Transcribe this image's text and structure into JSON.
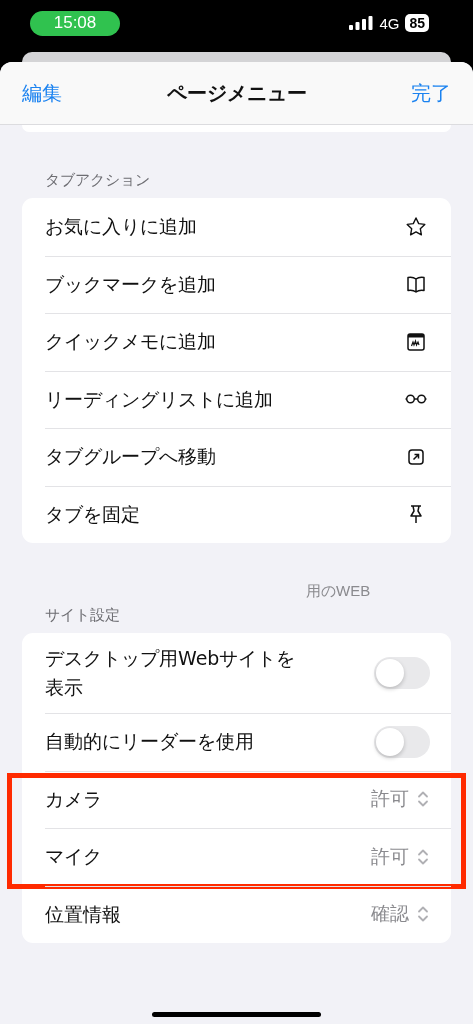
{
  "status_bar": {
    "time": "15:08",
    "network": "4G",
    "battery": "85"
  },
  "nav": {
    "left": "編集",
    "title": "ページメニュー",
    "right": "完了"
  },
  "sections": [
    {
      "header": "タブアクション",
      "rows": [
        {
          "kind": "action",
          "label": "お気に入りに追加"
        },
        {
          "kind": "action",
          "label": "ブックマークを追加"
        },
        {
          "kind": "action",
          "label": "クイックメモに追加"
        },
        {
          "kind": "action",
          "label": "リーディングリストに追加"
        },
        {
          "kind": "action",
          "label": "タブグループへ移動"
        },
        {
          "kind": "action",
          "label": "タブを固定"
        }
      ]
    },
    {
      "clipped_text": "用のWEB",
      "header": "サイト設定",
      "rows": [
        {
          "kind": "toggle",
          "label": "デスクトップ用Webサイトを表示",
          "on": false
        },
        {
          "kind": "toggle",
          "label": "自動的にリーダーを使用",
          "on": false
        },
        {
          "kind": "picker",
          "label": "カメラ",
          "value": "許可",
          "highlighted": true
        },
        {
          "kind": "picker",
          "label": "マイク",
          "value": "許可",
          "highlighted": true
        },
        {
          "kind": "picker",
          "label": "位置情報",
          "value": "確認"
        }
      ]
    }
  ]
}
